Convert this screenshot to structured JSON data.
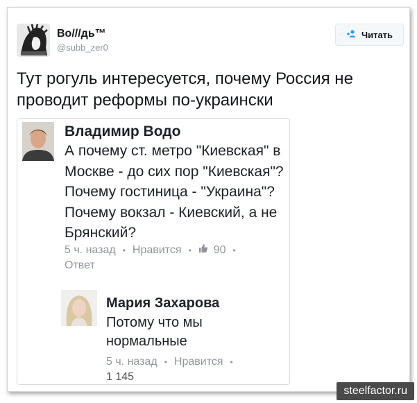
{
  "tweet": {
    "display_name": "Во///дь™",
    "handle": "@subb_zer0",
    "follow_label": "Читать",
    "text": "Тут рогуль интересуется, почему Россия не проводит реформы по-украински"
  },
  "embed": {
    "comments": [
      {
        "author": "Владимир Водо",
        "text": "А почему ст. метро \"Киевская\" в Москве - до сих пор \"Киевская\"? Почему гостиница - \"Украина\"? Почему вокзал - Киевский, а не Брянский?",
        "time": "5 ч. назад",
        "like_label": "Нравится",
        "likes": "90",
        "reply_label": "Ответ"
      },
      {
        "author": "Мария Захарова",
        "text": "Потому что мы нормальные",
        "time": "5 ч. назад",
        "like_label": "Нравится",
        "likes": "1 145"
      }
    ]
  },
  "watermark": "steelfactor.ru",
  "icons": {
    "follow": "add-user-icon",
    "like": "thumbs-up-icon"
  },
  "colors": {
    "twitter_blue": "#1da1f2",
    "fb_grey": "#90949c",
    "text": "#14171a"
  }
}
